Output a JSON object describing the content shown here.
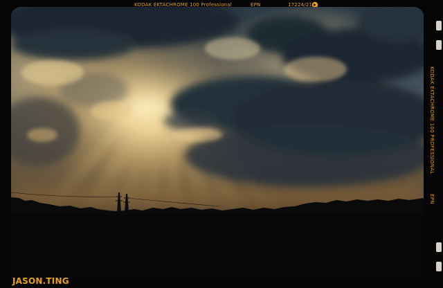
{
  "film_edge": {
    "stock_label": "KODAK EKTACHROME 100 Professional",
    "code_label": "EPN",
    "frame_number": "17224/21",
    "side_stock_label": "KODAK EKTACHROME 100 PROFESSIONAL",
    "side_code_label": "EPN",
    "arrow_icon": "frame-arrow-icon"
  },
  "photo": {
    "subject": "sun-rays-through-storm-clouds"
  },
  "signature": {
    "text": "JASON.TING"
  },
  "colors": {
    "edge_print": "#e8a21a",
    "frame_black": "#050505"
  }
}
